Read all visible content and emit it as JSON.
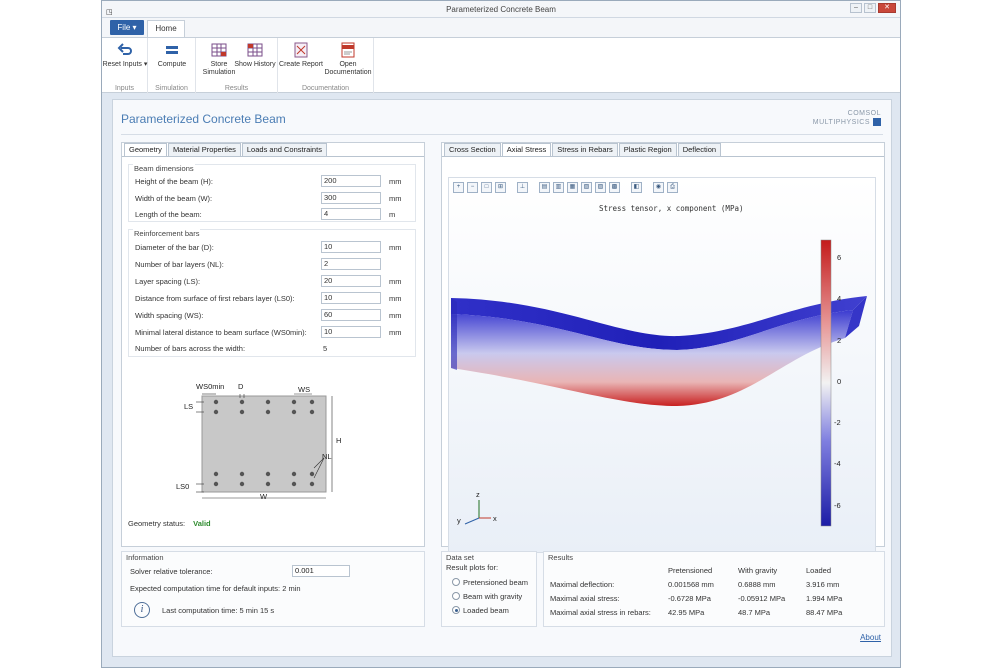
{
  "window": {
    "title": "Parameterized Concrete Beam",
    "app_icon": "◳",
    "min": "–",
    "max": "□",
    "close": "✕"
  },
  "ribbon": {
    "file_label": "File ▾",
    "home_tab": "Home",
    "groups": [
      {
        "label": "Inputs",
        "buttons": [
          {
            "label": "Reset Inputs ▾",
            "icon": "undo-icon"
          }
        ]
      },
      {
        "label": "Simulation",
        "buttons": [
          {
            "label": "Compute",
            "icon": "equals-icon"
          }
        ]
      },
      {
        "label": "Results",
        "buttons": [
          {
            "label": "Store Simulation",
            "icon": "table-icon"
          },
          {
            "label": "Show History",
            "icon": "history-icon"
          }
        ]
      },
      {
        "label": "Documentation",
        "buttons": [
          {
            "label": "Create Report",
            "icon": "report-icon"
          },
          {
            "label": "Open Documentation",
            "icon": "pdf-icon"
          }
        ]
      }
    ]
  },
  "app": {
    "title": "Parameterized Concrete Beam",
    "logo_line1": "COMSOL",
    "logo_line2": "MULTIPHYSICS"
  },
  "left_tabs": [
    "Geometry",
    "Material Properties",
    "Loads and Constraints"
  ],
  "beam": {
    "title": "Beam dimensions",
    "rows": [
      {
        "label": "Height of the beam (H):",
        "value": "200",
        "unit": "mm"
      },
      {
        "label": "Width of the beam (W):",
        "value": "300",
        "unit": "mm"
      },
      {
        "label": "Length of the beam:",
        "value": "4",
        "unit": "m"
      }
    ]
  },
  "rebars": {
    "title": "Reinforcement bars",
    "rows": [
      {
        "label": "Diameter of the bar (D):",
        "value": "10",
        "unit": "mm"
      },
      {
        "label": "Number of bar layers (NL):",
        "value": "2",
        "unit": ""
      },
      {
        "label": "Layer spacing (LS):",
        "value": "20",
        "unit": "mm"
      },
      {
        "label": "Distance from surface of first rebars layer (LS0):",
        "value": "10",
        "unit": "mm"
      },
      {
        "label": "Width spacing (WS):",
        "value": "60",
        "unit": "mm"
      },
      {
        "label": "Minimal lateral distance to beam surface (WS0min):",
        "value": "10",
        "unit": "mm"
      }
    ],
    "count_label": "Number of bars across the width:",
    "count_value": "5"
  },
  "diagram": {
    "ws0min": "WS0min",
    "d": "D",
    "ws": "WS",
    "ls": "LS",
    "h": "H",
    "nl": "NL",
    "ls0": "LS0",
    "w": "W"
  },
  "geometry_status": {
    "label": "Geometry status:",
    "value": "Valid"
  },
  "right_tabs": [
    "Cross Section",
    "Axial Stress",
    "Stress in Rebars",
    "Plastic Region",
    "Deflection"
  ],
  "plot": {
    "title": "Stress tensor, x component (MPa)",
    "toolbar": [
      "zoom-in-icon",
      "zoom-out-icon",
      "zoom-box-icon",
      "zoom-extents-icon",
      "sep",
      "axis-icon",
      "sep",
      "view-icon",
      "view-icon",
      "view-icon",
      "grid-icon",
      "grid-icon",
      "grid-icon",
      "sep",
      "scene-icon",
      "sep",
      "camera-icon",
      "print-icon"
    ],
    "colorbar_ticks": [
      "6",
      "4",
      "2",
      "0",
      "-2",
      "-4",
      "-6"
    ],
    "axis_y": "y",
    "axis_z": "z",
    "axis_x": "x"
  },
  "information": {
    "title": "Information",
    "tolerance_label": "Solver relative tolerance:",
    "tolerance_value": "0.001",
    "expected_label": "Expected computation time for default inputs:",
    "expected_value": "2 min",
    "last_label": "Last computation time: 5 min 15 s"
  },
  "dataset": {
    "title": "Data set",
    "subtitle": "Result plots for:",
    "options": [
      {
        "label": "Pretensioned beam",
        "selected": false
      },
      {
        "label": "Beam with gravity",
        "selected": false
      },
      {
        "label": "Loaded beam",
        "selected": true
      }
    ]
  },
  "results": {
    "title": "Results",
    "columns": [
      "Pretensioned",
      "With gravity",
      "Loaded"
    ],
    "rows": [
      {
        "label": "Maximal deflection:",
        "values": [
          "0.001568 mm",
          "0.6888 mm",
          "3.916 mm"
        ]
      },
      {
        "label": "Maximal axial stress:",
        "values": [
          "-0.6728 MPa",
          "-0.05912 MPa",
          "1.994 MPa"
        ]
      },
      {
        "label": "Maximal axial stress in rebars:",
        "values": [
          "42.95 MPa",
          "48.7 MPa",
          "88.47 MPa"
        ]
      }
    ]
  },
  "about": "About"
}
